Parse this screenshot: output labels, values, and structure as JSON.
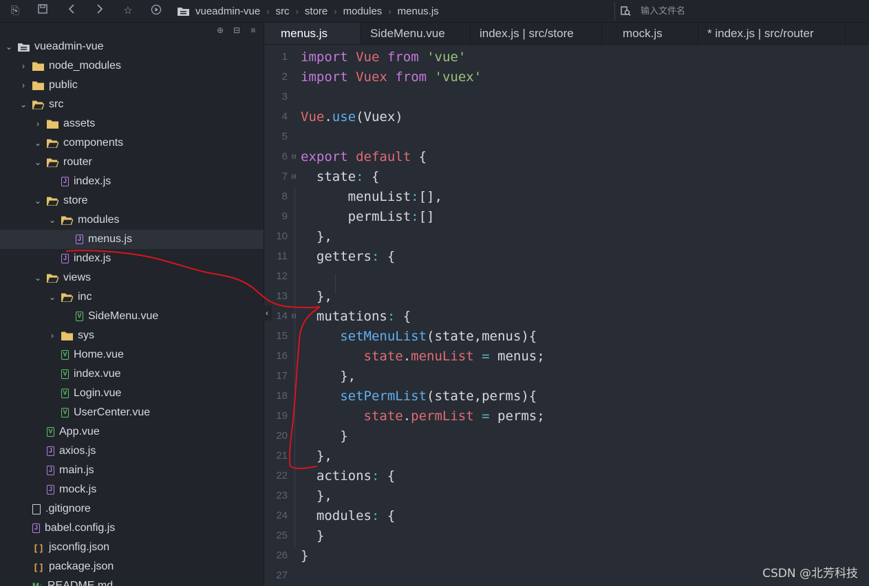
{
  "toolbar": {
    "icons": [
      "outline-icon",
      "save-icon",
      "back-icon",
      "forward-icon",
      "star-icon",
      "run-icon"
    ],
    "breadcrumb": [
      "vueadmin-vue",
      "src",
      "store",
      "modules",
      "menus.js"
    ],
    "search_placeholder": "输入文件名"
  },
  "sidebar": {
    "rows": [
      {
        "label": "vueadmin-vue",
        "type": "project",
        "depth": 0,
        "chevron": "open"
      },
      {
        "label": "node_modules",
        "type": "folder",
        "depth": 1,
        "chevron": "closed"
      },
      {
        "label": "public",
        "type": "folder",
        "depth": 1,
        "chevron": "closed"
      },
      {
        "label": "src",
        "type": "folder",
        "depth": 1,
        "chevron": "open"
      },
      {
        "label": "assets",
        "type": "folder",
        "depth": 2,
        "chevron": "closed"
      },
      {
        "label": "components",
        "type": "folder",
        "depth": 2,
        "chevron": "open"
      },
      {
        "label": "router",
        "type": "folder",
        "depth": 2,
        "chevron": "open"
      },
      {
        "label": "index.js",
        "type": "js",
        "depth": 3,
        "chevron": "none"
      },
      {
        "label": "store",
        "type": "folder",
        "depth": 2,
        "chevron": "open"
      },
      {
        "label": "modules",
        "type": "folder",
        "depth": 3,
        "chevron": "open"
      },
      {
        "label": "menus.js",
        "type": "js",
        "depth": 4,
        "chevron": "none",
        "selected": true
      },
      {
        "label": "index.js",
        "type": "js",
        "depth": 3,
        "chevron": "none"
      },
      {
        "label": "views",
        "type": "folder",
        "depth": 2,
        "chevron": "open"
      },
      {
        "label": "inc",
        "type": "folder",
        "depth": 3,
        "chevron": "open"
      },
      {
        "label": "SideMenu.vue",
        "type": "vue",
        "depth": 4,
        "chevron": "none"
      },
      {
        "label": "sys",
        "type": "folder",
        "depth": 3,
        "chevron": "closed"
      },
      {
        "label": "Home.vue",
        "type": "vue",
        "depth": 3,
        "chevron": "none"
      },
      {
        "label": "index.vue",
        "type": "vue",
        "depth": 3,
        "chevron": "none"
      },
      {
        "label": "Login.vue",
        "type": "vue",
        "depth": 3,
        "chevron": "none"
      },
      {
        "label": "UserCenter.vue",
        "type": "vue",
        "depth": 3,
        "chevron": "none"
      },
      {
        "label": "App.vue",
        "type": "vue",
        "depth": 2,
        "chevron": "none"
      },
      {
        "label": "axios.js",
        "type": "js",
        "depth": 2,
        "chevron": "none"
      },
      {
        "label": "main.js",
        "type": "js",
        "depth": 2,
        "chevron": "none"
      },
      {
        "label": "mock.js",
        "type": "js",
        "depth": 2,
        "chevron": "none"
      },
      {
        "label": ".gitignore",
        "type": "file",
        "depth": 1,
        "chevron": "none"
      },
      {
        "label": "babel.config.js",
        "type": "js",
        "depth": 1,
        "chevron": "none"
      },
      {
        "label": "jsconfig.json",
        "type": "json",
        "depth": 1,
        "chevron": "none"
      },
      {
        "label": "package.json",
        "type": "json",
        "depth": 1,
        "chevron": "none"
      },
      {
        "label": "README.md",
        "type": "md",
        "depth": 1,
        "chevron": "none"
      }
    ]
  },
  "tabs": [
    {
      "label": "menus.js",
      "active": true
    },
    {
      "label": "SideMenu.vue",
      "active": false
    },
    {
      "label": "index.js | src/store",
      "active": false
    },
    {
      "label": "mock.js",
      "active": false
    },
    {
      "label": "* index.js | src/router",
      "active": false
    }
  ],
  "editor": {
    "lines": [
      {
        "n": "1",
        "fold": "",
        "tokens": [
          [
            "kw",
            "import"
          ],
          [
            "plain",
            " "
          ],
          [
            "cls",
            "Vue"
          ],
          [
            "plain",
            " "
          ],
          [
            "kw",
            "from"
          ],
          [
            "plain",
            " "
          ],
          [
            "str",
            "'vue'"
          ]
        ]
      },
      {
        "n": "2",
        "fold": "",
        "tokens": [
          [
            "kw",
            "import"
          ],
          [
            "plain",
            " "
          ],
          [
            "cls",
            "Vuex"
          ],
          [
            "plain",
            " "
          ],
          [
            "kw",
            "from"
          ],
          [
            "plain",
            " "
          ],
          [
            "str",
            "'vuex'"
          ]
        ]
      },
      {
        "n": "3",
        "fold": "",
        "tokens": []
      },
      {
        "n": "4",
        "fold": "",
        "tokens": [
          [
            "cls",
            "Vue"
          ],
          [
            "plain",
            "."
          ],
          [
            "fn",
            "use"
          ],
          [
            "plain",
            "(Vuex)"
          ]
        ]
      },
      {
        "n": "5",
        "fold": "",
        "tokens": []
      },
      {
        "n": "6",
        "fold": "⊟",
        "tokens": [
          [
            "kw",
            "export"
          ],
          [
            "plain",
            " "
          ],
          [
            "cls",
            "default"
          ],
          [
            "plain",
            " {"
          ]
        ]
      },
      {
        "n": "7",
        "fold": "⊟",
        "tokens": [
          [
            "plain",
            "  state"
          ],
          [
            "op",
            ":"
          ],
          [
            "plain",
            " {"
          ]
        ]
      },
      {
        "n": "8",
        "fold": "",
        "tokens": [
          [
            "plain",
            "      menuList"
          ],
          [
            "op",
            ":"
          ],
          [
            "plain",
            "[],"
          ]
        ]
      },
      {
        "n": "9",
        "fold": "",
        "tokens": [
          [
            "plain",
            "      permList"
          ],
          [
            "op",
            ":"
          ],
          [
            "plain",
            "[]"
          ]
        ]
      },
      {
        "n": "10",
        "fold": "",
        "tokens": [
          [
            "plain",
            "  },"
          ]
        ]
      },
      {
        "n": "11",
        "fold": "",
        "tokens": [
          [
            "plain",
            "  getters"
          ],
          [
            "op",
            ":"
          ],
          [
            "plain",
            " {"
          ]
        ]
      },
      {
        "n": "12",
        "fold": "",
        "tokens": []
      },
      {
        "n": "13",
        "fold": "",
        "tokens": [
          [
            "plain",
            "  },"
          ]
        ]
      },
      {
        "n": "14",
        "fold": "⊟",
        "tokens": [
          [
            "plain",
            "  mutations"
          ],
          [
            "op",
            ":"
          ],
          [
            "plain",
            " {"
          ]
        ]
      },
      {
        "n": "15",
        "fold": "",
        "tokens": [
          [
            "plain",
            "     "
          ],
          [
            "fn",
            "setMenuList"
          ],
          [
            "plain",
            "(state,menus){"
          ]
        ]
      },
      {
        "n": "16",
        "fold": "",
        "tokens": [
          [
            "plain",
            "        "
          ],
          [
            "prop",
            "state"
          ],
          [
            "plain",
            "."
          ],
          [
            "prop",
            "menuList"
          ],
          [
            "plain",
            " "
          ],
          [
            "op",
            "="
          ],
          [
            "plain",
            " menus;"
          ]
        ]
      },
      {
        "n": "17",
        "fold": "",
        "tokens": [
          [
            "plain",
            "     },"
          ]
        ]
      },
      {
        "n": "18",
        "fold": "",
        "tokens": [
          [
            "plain",
            "     "
          ],
          [
            "fn",
            "setPermList"
          ],
          [
            "plain",
            "(state,perms){"
          ]
        ]
      },
      {
        "n": "19",
        "fold": "",
        "tokens": [
          [
            "plain",
            "        "
          ],
          [
            "prop",
            "state"
          ],
          [
            "plain",
            "."
          ],
          [
            "prop",
            "permList"
          ],
          [
            "plain",
            " "
          ],
          [
            "op",
            "="
          ],
          [
            "plain",
            " perms;"
          ]
        ]
      },
      {
        "n": "20",
        "fold": "",
        "tokens": [
          [
            "plain",
            "     }"
          ]
        ]
      },
      {
        "n": "21",
        "fold": "",
        "tokens": [
          [
            "plain",
            "  },"
          ]
        ]
      },
      {
        "n": "22",
        "fold": "",
        "tokens": [
          [
            "plain",
            "  actions"
          ],
          [
            "op",
            ":"
          ],
          [
            "plain",
            " {"
          ]
        ]
      },
      {
        "n": "23",
        "fold": "",
        "tokens": [
          [
            "plain",
            "  },"
          ]
        ]
      },
      {
        "n": "24",
        "fold": "",
        "tokens": [
          [
            "plain",
            "  modules"
          ],
          [
            "op",
            ":"
          ],
          [
            "plain",
            " {"
          ]
        ]
      },
      {
        "n": "25",
        "fold": "",
        "tokens": [
          [
            "plain",
            "  }"
          ]
        ]
      },
      {
        "n": "26",
        "fold": "",
        "tokens": [
          [
            "plain",
            "}"
          ]
        ]
      },
      {
        "n": "27",
        "fold": "",
        "tokens": []
      }
    ]
  },
  "watermark": "CSDN @北芳科技",
  "colors": {
    "keyword": "#c678dd",
    "class": "#e06c75",
    "string": "#98c379",
    "function": "#61afef",
    "operator": "#56b6c2",
    "annotation": "#e0191c"
  }
}
